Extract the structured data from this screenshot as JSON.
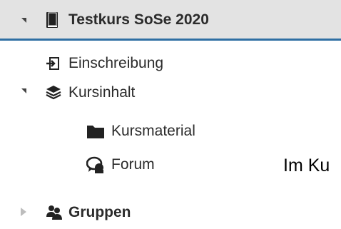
{
  "tree": {
    "course": {
      "label": "Testkurs SoSe 2020",
      "icon": "book-icon"
    },
    "items": [
      {
        "label": "Einschreibung",
        "icon": "enrollment-icon"
      },
      {
        "label": "Kursinhalt",
        "icon": "layers-icon"
      },
      {
        "label": "Kursmaterial",
        "icon": "folder-icon"
      },
      {
        "label": "Forum",
        "icon": "forum-icon"
      },
      {
        "label": "Gruppen",
        "icon": "groups-icon"
      }
    ]
  },
  "content": {
    "partial_text": "Im Ku"
  },
  "colors": {
    "selected_bg": "#e3e3e3",
    "accent": "#2f6fa3"
  }
}
